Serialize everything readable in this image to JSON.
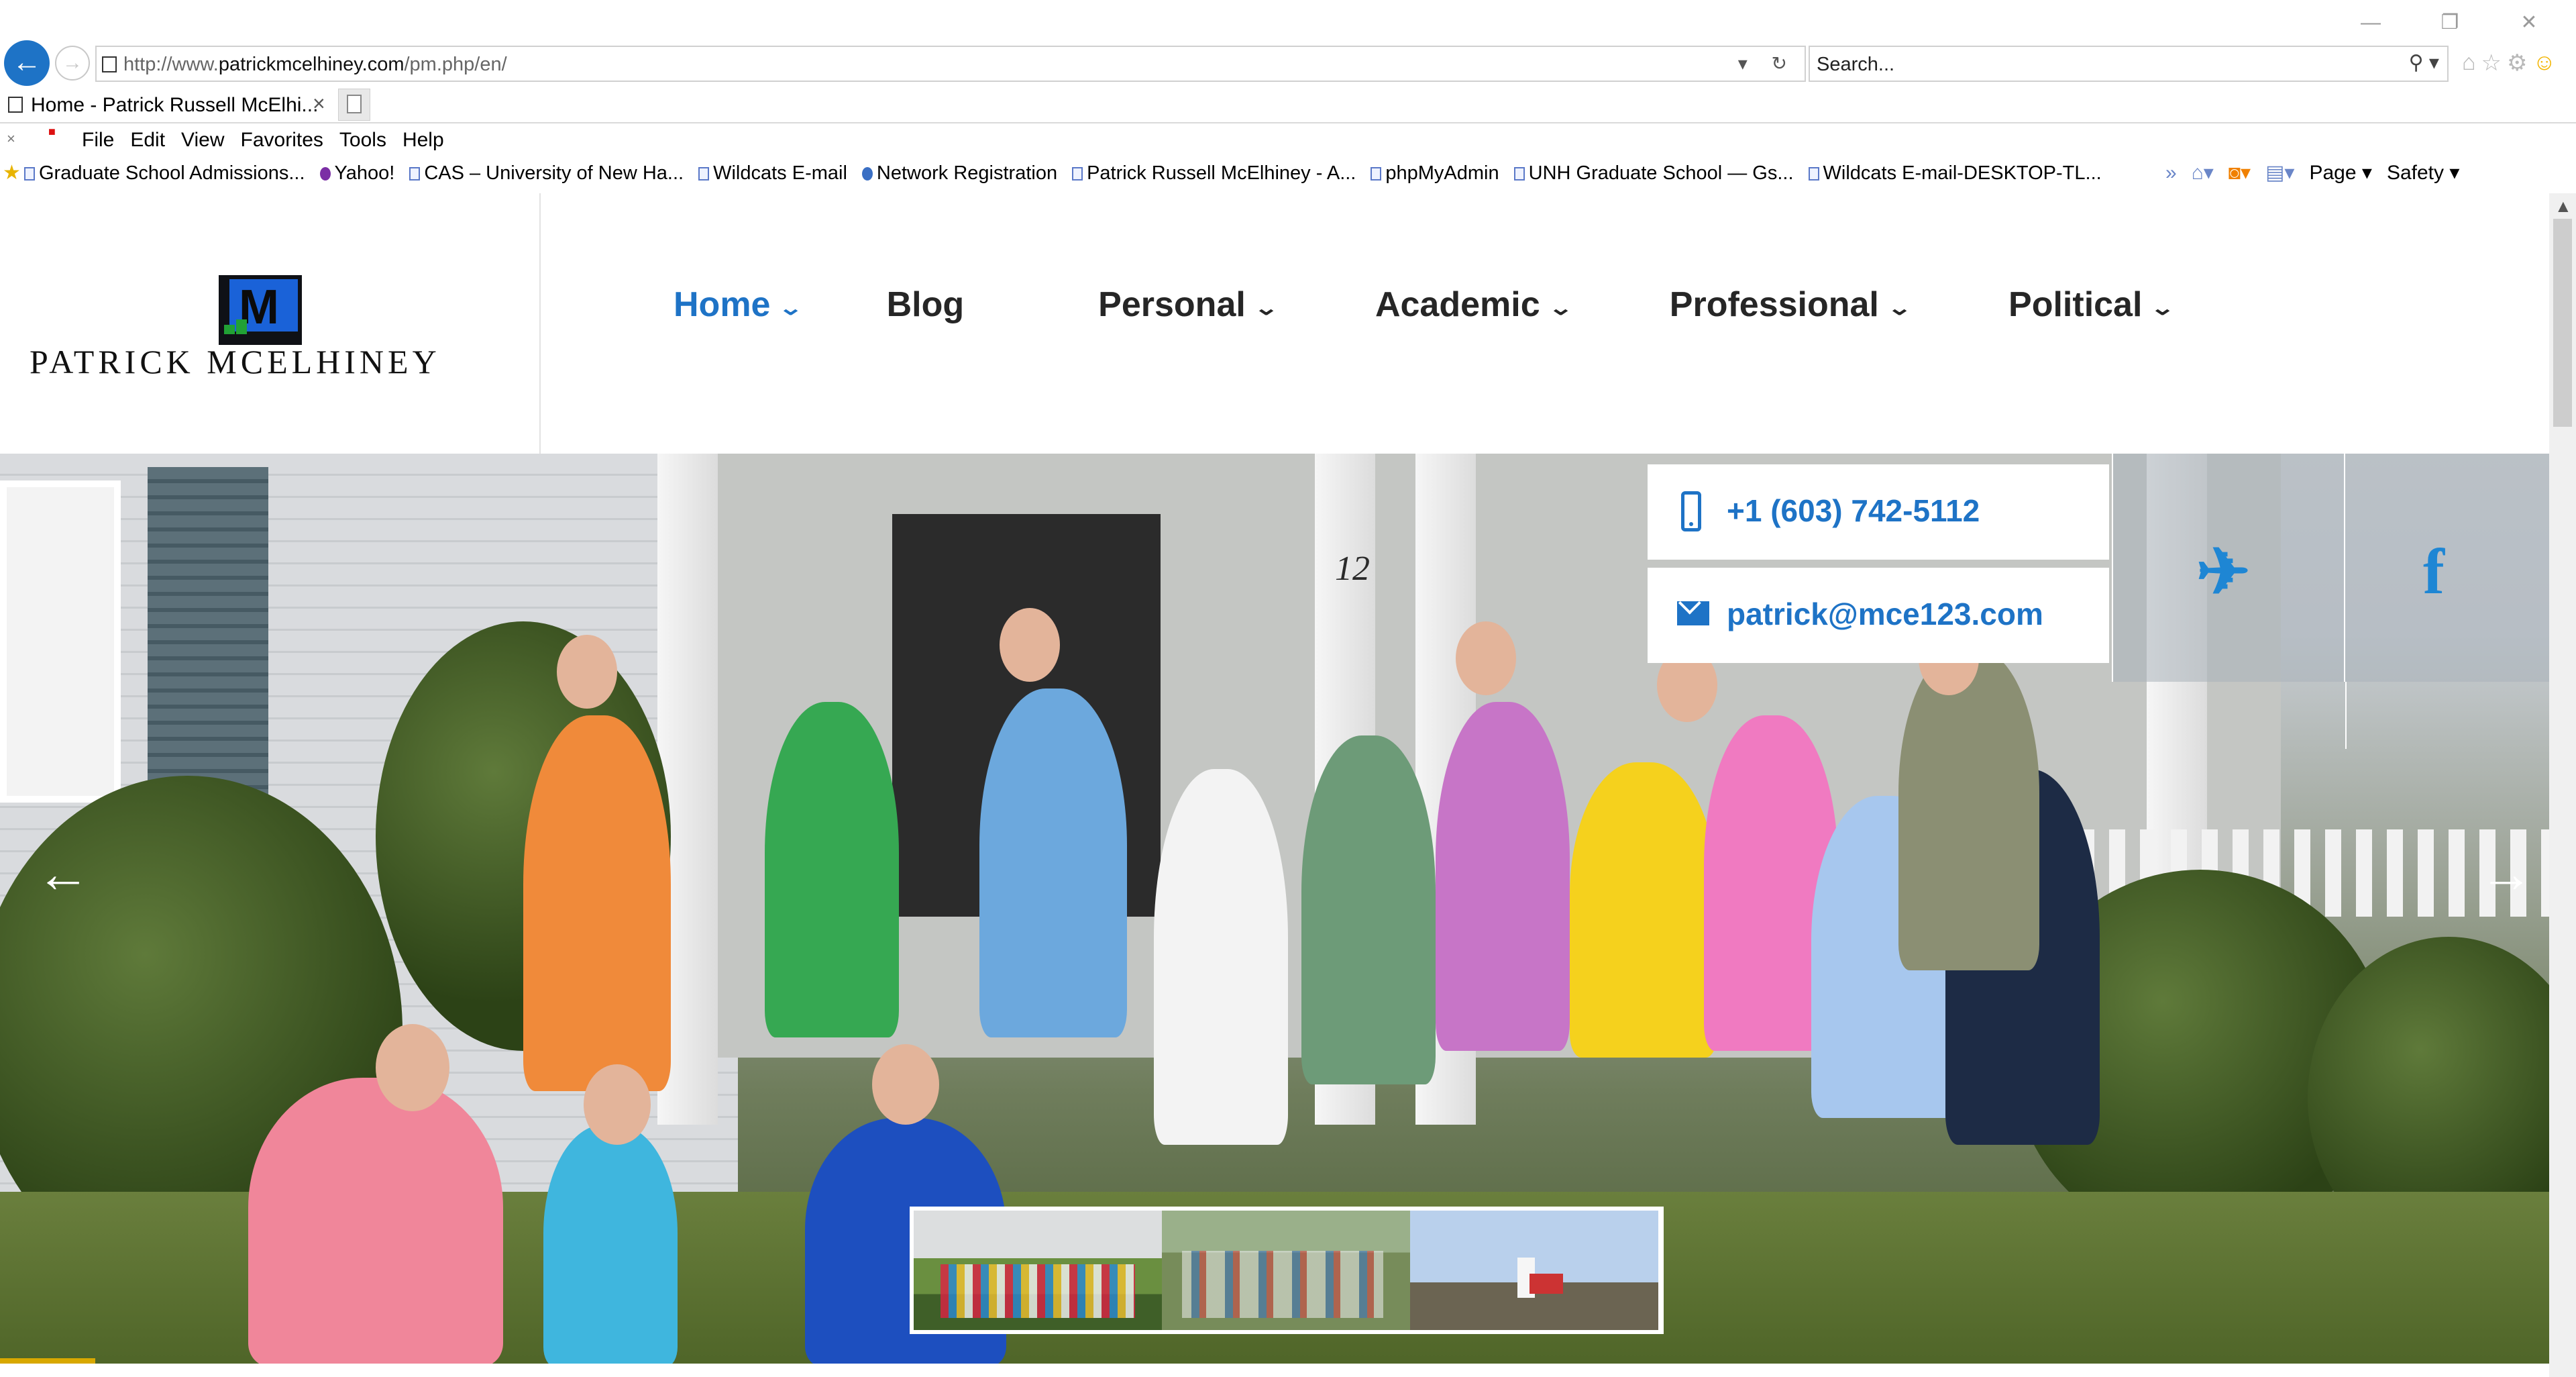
{
  "browser": {
    "address": {
      "prefix": "http://www.",
      "domain": "patrickmcelhiney.com",
      "path": "/pm.php/en/"
    },
    "search": {
      "value": "Search..."
    },
    "tab": {
      "title": "Home - Patrick Russell McElhi...",
      "close": "×"
    },
    "menu": [
      "File",
      "Edit",
      "View",
      "Favorites",
      "Tools",
      "Help"
    ],
    "favorites": [
      "Graduate School Admissions...",
      "Yahoo!",
      "CAS – University of New Ha...",
      "Wildcats E-mail",
      "Network Registration",
      "Patrick Russell McElhiney - A...",
      "phpMyAdmin",
      "UNH Graduate School — Gs...",
      "Wildcats E-mail-DESKTOP-TL..."
    ],
    "command_bar": {
      "page": "Page",
      "safety": "Safety"
    },
    "icons": {
      "back": "back-arrow-icon",
      "forward": "forward-arrow-icon",
      "refresh": "refresh-icon",
      "search": "search-icon",
      "home": "home-icon",
      "favorites": "star-icon",
      "settings": "gear-icon",
      "feedback": "smiley-icon"
    }
  },
  "site": {
    "logo_text": "Patrick McElhiney",
    "nav": [
      {
        "label": "Home",
        "active": true,
        "dropdown": true
      },
      {
        "label": "Blog",
        "active": false,
        "dropdown": false
      },
      {
        "label": "Personal",
        "active": false,
        "dropdown": true
      },
      {
        "label": "Academic",
        "active": false,
        "dropdown": true
      },
      {
        "label": "Professional",
        "active": false,
        "dropdown": true
      },
      {
        "label": "Political",
        "active": false,
        "dropdown": true
      }
    ],
    "contact": {
      "phone": "+1 (603) 742-5112",
      "email": "patrick@mce123.com"
    },
    "social": [
      "twitter-icon",
      "facebook-icon"
    ],
    "slider": {
      "thumbnails": [
        "family-group-porch",
        "family-group-outdoors",
        "lighthouse"
      ],
      "house_number": "12"
    },
    "colors": {
      "accent": "#1e73c6",
      "nav_text": "#262626",
      "progress": "#d8a800"
    }
  }
}
